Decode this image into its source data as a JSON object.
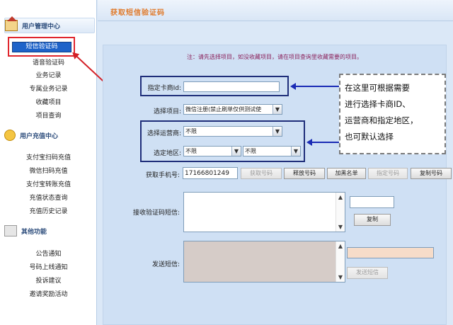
{
  "page_title": "获取短信验证码",
  "sidebar": {
    "sections": [
      {
        "title": "用户管理中心",
        "icon": "home-icon"
      },
      {
        "title": "用户充值中心",
        "icon": "coin-icon"
      },
      {
        "title": "其他功能",
        "icon": "tools-icon"
      }
    ],
    "user_items": [
      "短信验证码",
      "语音验证码",
      "业务记录",
      "专属业务记录",
      "收藏项目",
      "项目查询"
    ],
    "recharge_items": [
      "支付宝扫码充值",
      "微信扫码充值",
      "支付宝转账充值",
      "充值状态查询",
      "充值历史记录"
    ],
    "other_items": [
      "公告通知",
      "号码上线通知",
      "投诉建议",
      "邀请奖励活动"
    ]
  },
  "form": {
    "notice": "注：请先选择项目，如没收藏项目，请在项目查询里收藏需要的项目。",
    "card_merchant_label": "指定卡商Id:",
    "card_merchant_value": "",
    "project_label": "选择项目:",
    "project_value": "微信注册(禁止刷单仅供测试使",
    "operator_label": "选择运营商:",
    "operator_value": "不限",
    "region_label": "选定地区:",
    "region_province": "不限",
    "region_city": "不限",
    "phone_label": "获取手机号:",
    "phone_value": "17166801249",
    "buttons": {
      "get_number": "获取号码",
      "release_number": "释放号码",
      "blacklist": "加黑名单",
      "specify_number": "指定号码",
      "copy_number": "复制号码",
      "copy": "复制",
      "send_sms": "发送短信"
    },
    "receive_label": "接收验证码短信:",
    "send_label": "发送短信:"
  },
  "callout": {
    "lines": [
      "在这里可根据需要",
      "进行选择卡商ID、",
      "运营商和指定地区，",
      "也可默认选择"
    ]
  },
  "colors": {
    "title": "#e07a2b",
    "annotation_box": "#1f2e7a",
    "annotation_arrow": "#1a2bb5",
    "highlight_red": "#e0262d",
    "active_nav": "#1e63c9"
  }
}
